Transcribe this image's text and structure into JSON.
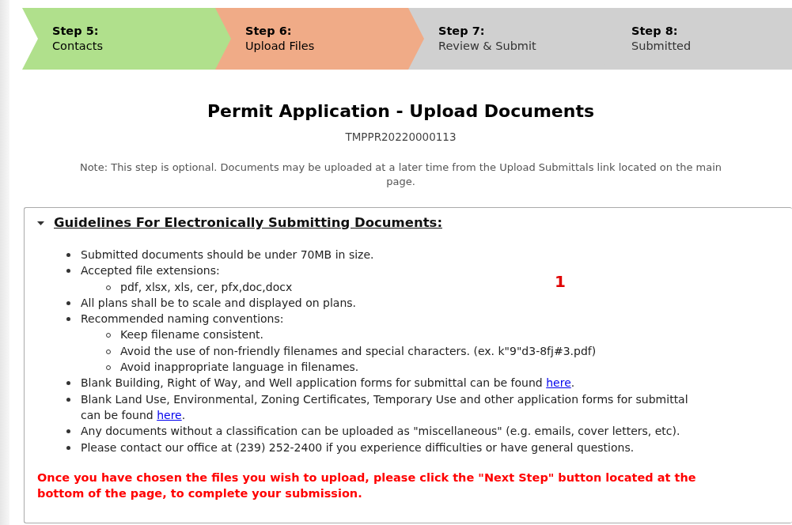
{
  "steps": [
    {
      "number": "Step 5:",
      "label": "Contacts",
      "completed": true,
      "selected": false
    },
    {
      "number": "Step 6:",
      "label": "Upload Files",
      "completed": false,
      "selected": true
    },
    {
      "number": "Step 7:",
      "label": "Review & Submit",
      "completed": false,
      "selected": false
    },
    {
      "number": "Step 8:",
      "label": "Submitted",
      "completed": false,
      "selected": false
    }
  ],
  "title": "Permit Application - Upload Documents",
  "record_id": "TMPPR20220000113",
  "note_lines": [
    "Note: This step is optional. Documents may be uploaded at a later time from the Upload Submittals link located on the main",
    "page."
  ],
  "guidelines": {
    "heading": "Guidelines For Electronically Submitting Documents:",
    "expanded": true,
    "annotation_marker": "1",
    "items": [
      {
        "text": "Submitted documents should be under 70MB in size."
      },
      {
        "text": "Accepted file extensions:",
        "children": [
          {
            "text": "pdf, xlsx, xls, cer, pfx,doc,docx"
          }
        ]
      },
      {
        "text": "All plans shall be to scale and displayed on plans."
      },
      {
        "text": "Recommended naming conventions:",
        "children": [
          {
            "text": "Keep filename consistent."
          },
          {
            "text": "Avoid the use of non-friendly filenames and special characters. (ex. k\"9\"d3-8fj#3.pdf)"
          },
          {
            "text": "Avoid inappropriate language in filenames."
          }
        ]
      },
      {
        "text": "Blank Building, Right of Way, and Well application forms for submittal can be found ",
        "link": "here",
        "suffix": "."
      },
      {
        "text": "Blank Land Use, Environmental, Zoning Certificates, Temporary Use and other application forms for submittal can be found ",
        "link": "here",
        "suffix": "."
      },
      {
        "text": "Any documents without a classification can be uploaded as \"miscellaneous\" (e.g. emails, cover letters, etc)."
      },
      {
        "text": "Please contact our office at (239) 252-2400 if you experience difficulties or have general questions."
      }
    ],
    "warning": "Once you have chosen the files you wish to upload, please click the \"Next Step\" button located at the bottom of the page, to complete your submission."
  }
}
